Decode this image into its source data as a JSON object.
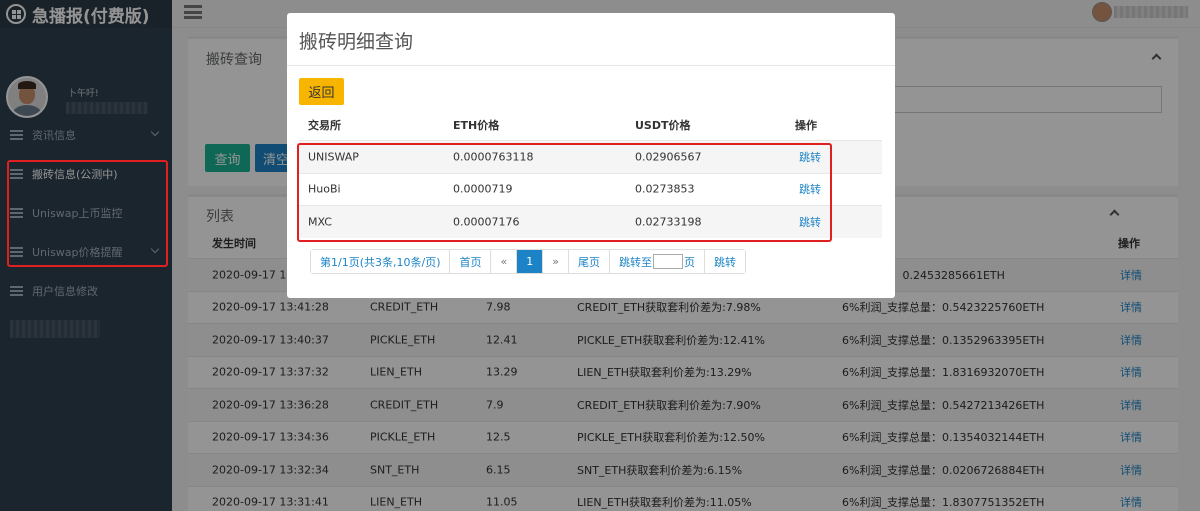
{
  "app": {
    "title": "急播报(付费版)"
  },
  "profile": {
    "name": "卜午吁!"
  },
  "sidebar": {
    "items": [
      {
        "label": "资讯信息",
        "has_chevron": true
      },
      {
        "label": "搬砖信息(公测中)",
        "has_chevron": false
      },
      {
        "label": "Uniswap上币监控",
        "has_chevron": false
      },
      {
        "label": "Uniswap价格提醒",
        "has_chevron": true
      },
      {
        "label": "用户信息修改",
        "has_chevron": false
      }
    ]
  },
  "query_panel": {
    "title": "搬砖查询",
    "query_label": "查询",
    "clear_label": "清空"
  },
  "list_panel": {
    "title": "列表",
    "headers": {
      "time": "发生时间",
      "action": "操作"
    },
    "rows": [
      {
        "time": "2020-09-17 13:4",
        "pair": "",
        "ratio": "",
        "desc": "",
        "profit": "_支撑总量：0.2453285661ETH",
        "action": "详情"
      },
      {
        "time": "2020-09-17 13:41:28",
        "pair": "CREDIT_ETH",
        "ratio": "7.98",
        "desc": "CREDIT_ETH获取套利价差为:7.98%",
        "profit": "6%利润_支撑总量：0.5423225760ETH",
        "action": "详情"
      },
      {
        "time": "2020-09-17 13:40:37",
        "pair": "PICKLE_ETH",
        "ratio": "12.41",
        "desc": "PICKLE_ETH获取套利价差为:12.41%",
        "profit": "6%利润_支撑总量：0.1352963395ETH",
        "action": "详情"
      },
      {
        "time": "2020-09-17 13:37:32",
        "pair": "LIEN_ETH",
        "ratio": "13.29",
        "desc": "LIEN_ETH获取套利价差为:13.29%",
        "profit": "6%利润_支撑总量：1.8316932070ETH",
        "action": "详情"
      },
      {
        "time": "2020-09-17 13:36:28",
        "pair": "CREDIT_ETH",
        "ratio": "7.9",
        "desc": "CREDIT_ETH获取套利价差为:7.90%",
        "profit": "6%利润_支撑总量：0.5427213426ETH",
        "action": "详情"
      },
      {
        "time": "2020-09-17 13:34:36",
        "pair": "PICKLE_ETH",
        "ratio": "12.5",
        "desc": "PICKLE_ETH获取套利价差为:12.50%",
        "profit": "6%利润_支撑总量：0.1354032144ETH",
        "action": "详情"
      },
      {
        "time": "2020-09-17 13:32:34",
        "pair": "SNT_ETH",
        "ratio": "6.15",
        "desc": "SNT_ETH获取套利价差为:6.15%",
        "profit": "6%利润_支撑总量：0.0206726884ETH",
        "action": "详情"
      },
      {
        "time": "2020-09-17 13:31:41",
        "pair": "LIEN_ETH",
        "ratio": "11.05",
        "desc": "LIEN_ETH获取套利价差为:11.05%",
        "profit": "6%利润_支撑总量：1.8307751352ETH",
        "action": "详情"
      }
    ]
  },
  "modal": {
    "title": "搬砖明细查询",
    "back_label": "返回",
    "headers": {
      "exchange": "交易所",
      "eth_price": "ETH价格",
      "usdt_price": "USDT价格",
      "action": "操作"
    },
    "rows": [
      {
        "exchange": "UNISWAP",
        "eth_price": "0.0000763118",
        "usdt_price": "0.02906567",
        "action": "跳转"
      },
      {
        "exchange": "HuoBi",
        "eth_price": "0.0000719",
        "usdt_price": "0.0273853",
        "action": "跳转"
      },
      {
        "exchange": "MXC",
        "eth_price": "0.00007176",
        "usdt_price": "0.02733198",
        "action": "跳转"
      }
    ],
    "pagination": {
      "summary": "第1/1页(共3条,10条/页)",
      "first": "首页",
      "prev": "«",
      "current": "1",
      "next": "»",
      "last": "尾页",
      "jump_prefix": "跳转至",
      "jump_suffix": "页",
      "jump_button": "跳转"
    }
  }
}
